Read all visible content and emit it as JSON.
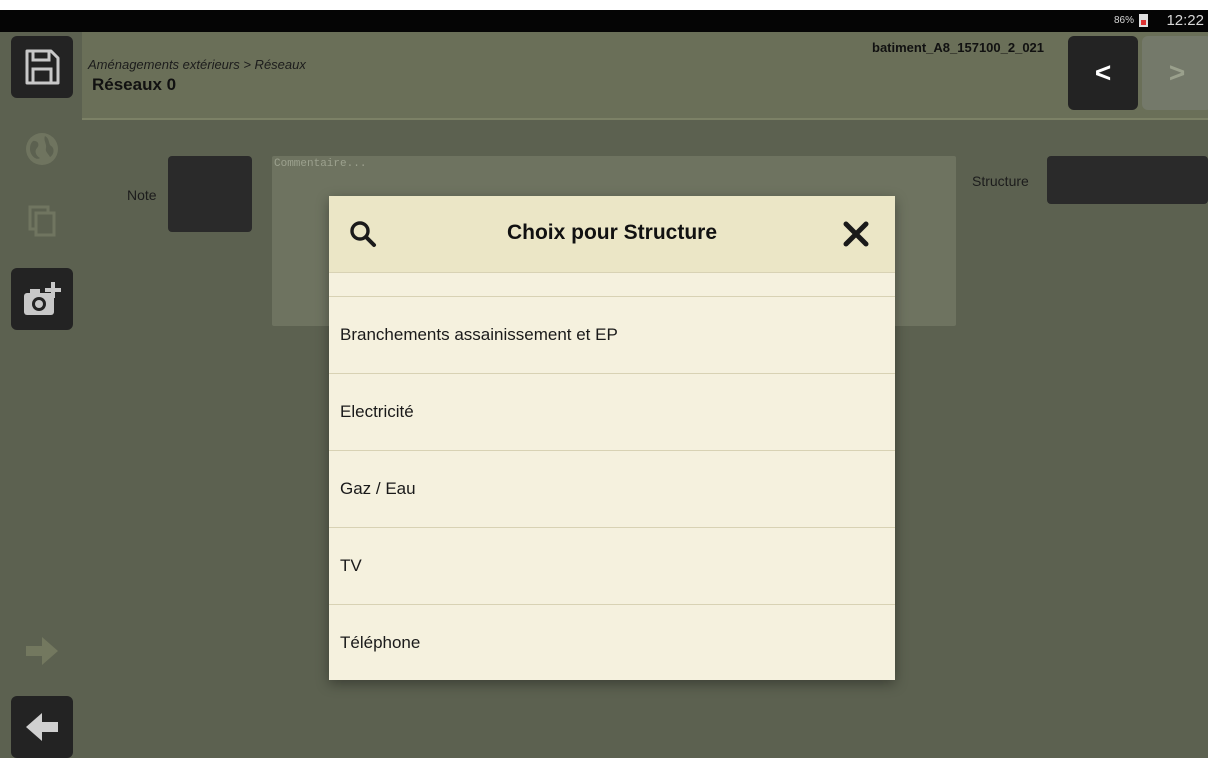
{
  "status_bar": {
    "battery": "86%",
    "time": "12:22"
  },
  "header": {
    "breadcrumb": "Aménagements extérieurs > Réseaux",
    "title": "Réseaux 0",
    "document_id": "batiment_A8_157100_2_021",
    "prev_label": "<",
    "next_label": ">"
  },
  "form": {
    "note_label": "Note",
    "comment_placeholder": "Commentaire...",
    "structure_label": "Structure"
  },
  "dialog": {
    "title": "Choix pour Structure",
    "items": [
      {
        "label": ""
      },
      {
        "label": "Branchements assainissement et EP"
      },
      {
        "label": "Electricité"
      },
      {
        "label": "Gaz / Eau"
      },
      {
        "label": "TV"
      },
      {
        "label": "Téléphone"
      }
    ]
  }
}
